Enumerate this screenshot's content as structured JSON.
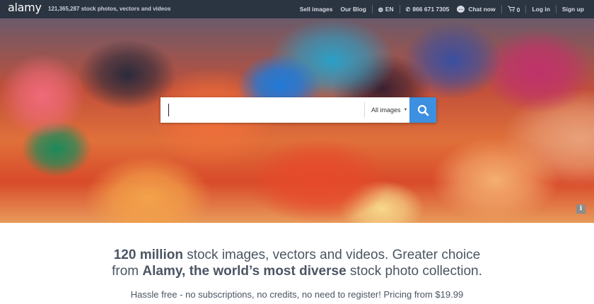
{
  "brand": {
    "logo": "alamy",
    "count": "121,365,287",
    "tagline_rest": "stock photos, vectors and videos"
  },
  "nav": {
    "sell_images": "Sell images",
    "our_blog": "Our Blog",
    "language": "EN",
    "phone": "866 671 7305",
    "chat": "Chat now",
    "cart_count": "0",
    "login": "Log in",
    "signup": "Sign up"
  },
  "icons": {
    "globe": "globe-icon",
    "phone": "phone-icon",
    "chat": "chat-bubble-icon",
    "cart": "cart-icon",
    "search": "search-icon",
    "info": "info-icon"
  },
  "search": {
    "value": "",
    "placeholder": "",
    "scope": "All images",
    "button_label": "search"
  },
  "hero_info": "i",
  "headline": {
    "line1_bold": "120 million",
    "line1_rest": " stock images, vectors and videos. Greater choice",
    "line2_start": "from ",
    "line2_bold": "Alamy, the world’s most diverse",
    "line2_end": " stock photo collection."
  },
  "subline": "Hassle free - no subscriptions, no credits, no need to register! Pricing from $19.99",
  "colors": {
    "topbar": "#2b3441",
    "accent": "#3d8fe0",
    "text": "#4b5563"
  }
}
